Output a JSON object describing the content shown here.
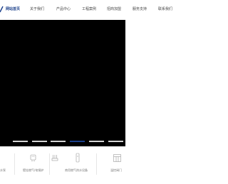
{
  "nav": {
    "items": [
      {
        "label": "网站首页",
        "active": true
      },
      {
        "label": "关于我们",
        "active": false
      },
      {
        "label": "产品中心",
        "active": false
      },
      {
        "label": "工程案例",
        "active": false
      },
      {
        "label": "招商加盟",
        "active": false
      },
      {
        "label": "服务支持",
        "active": false
      },
      {
        "label": "联系我们",
        "active": false
      }
    ],
    "active_color": "#1a3f8a"
  },
  "banner": {
    "background": "#000000",
    "slide_count": 6,
    "active_slide": 4
  },
  "categories": [
    {
      "label": "水泵",
      "icon": "pump-icon"
    },
    {
      "label": "壁挂燃气/电锅炉",
      "icon": "boiler-icon"
    },
    {
      "label": "",
      "icon": "heating-set-icon"
    },
    {
      "label": "商用燃气热水设备",
      "icon": "water-heater-icon"
    },
    {
      "label": "温控阀门",
      "icon": "valve-panel-icon"
    }
  ]
}
